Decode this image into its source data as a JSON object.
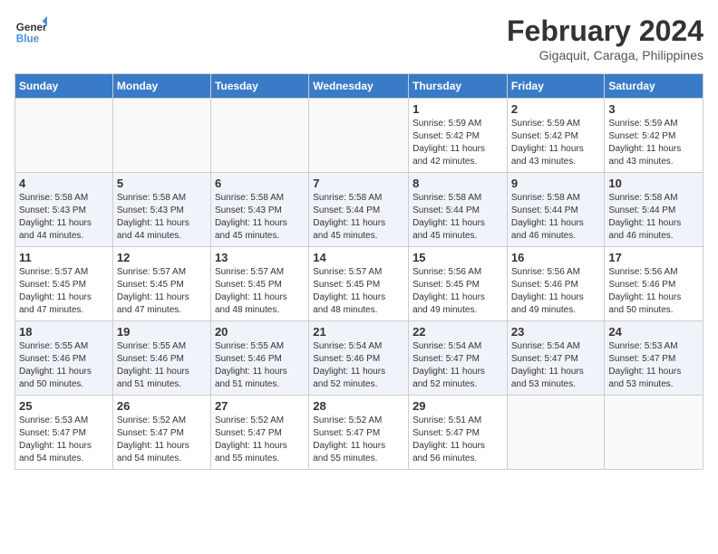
{
  "header": {
    "logo_line1": "General",
    "logo_line2": "Blue",
    "month_year": "February 2024",
    "location": "Gigaquit, Caraga, Philippines"
  },
  "weekdays": [
    "Sunday",
    "Monday",
    "Tuesday",
    "Wednesday",
    "Thursday",
    "Friday",
    "Saturday"
  ],
  "weeks": [
    [
      {
        "day": "",
        "info": ""
      },
      {
        "day": "",
        "info": ""
      },
      {
        "day": "",
        "info": ""
      },
      {
        "day": "",
        "info": ""
      },
      {
        "day": "1",
        "info": "Sunrise: 5:59 AM\nSunset: 5:42 PM\nDaylight: 11 hours\nand 42 minutes."
      },
      {
        "day": "2",
        "info": "Sunrise: 5:59 AM\nSunset: 5:42 PM\nDaylight: 11 hours\nand 43 minutes."
      },
      {
        "day": "3",
        "info": "Sunrise: 5:59 AM\nSunset: 5:42 PM\nDaylight: 11 hours\nand 43 minutes."
      }
    ],
    [
      {
        "day": "4",
        "info": "Sunrise: 5:58 AM\nSunset: 5:43 PM\nDaylight: 11 hours\nand 44 minutes."
      },
      {
        "day": "5",
        "info": "Sunrise: 5:58 AM\nSunset: 5:43 PM\nDaylight: 11 hours\nand 44 minutes."
      },
      {
        "day": "6",
        "info": "Sunrise: 5:58 AM\nSunset: 5:43 PM\nDaylight: 11 hours\nand 45 minutes."
      },
      {
        "day": "7",
        "info": "Sunrise: 5:58 AM\nSunset: 5:44 PM\nDaylight: 11 hours\nand 45 minutes."
      },
      {
        "day": "8",
        "info": "Sunrise: 5:58 AM\nSunset: 5:44 PM\nDaylight: 11 hours\nand 45 minutes."
      },
      {
        "day": "9",
        "info": "Sunrise: 5:58 AM\nSunset: 5:44 PM\nDaylight: 11 hours\nand 46 minutes."
      },
      {
        "day": "10",
        "info": "Sunrise: 5:58 AM\nSunset: 5:44 PM\nDaylight: 11 hours\nand 46 minutes."
      }
    ],
    [
      {
        "day": "11",
        "info": "Sunrise: 5:57 AM\nSunset: 5:45 PM\nDaylight: 11 hours\nand 47 minutes."
      },
      {
        "day": "12",
        "info": "Sunrise: 5:57 AM\nSunset: 5:45 PM\nDaylight: 11 hours\nand 47 minutes."
      },
      {
        "day": "13",
        "info": "Sunrise: 5:57 AM\nSunset: 5:45 PM\nDaylight: 11 hours\nand 48 minutes."
      },
      {
        "day": "14",
        "info": "Sunrise: 5:57 AM\nSunset: 5:45 PM\nDaylight: 11 hours\nand 48 minutes."
      },
      {
        "day": "15",
        "info": "Sunrise: 5:56 AM\nSunset: 5:45 PM\nDaylight: 11 hours\nand 49 minutes."
      },
      {
        "day": "16",
        "info": "Sunrise: 5:56 AM\nSunset: 5:46 PM\nDaylight: 11 hours\nand 49 minutes."
      },
      {
        "day": "17",
        "info": "Sunrise: 5:56 AM\nSunset: 5:46 PM\nDaylight: 11 hours\nand 50 minutes."
      }
    ],
    [
      {
        "day": "18",
        "info": "Sunrise: 5:55 AM\nSunset: 5:46 PM\nDaylight: 11 hours\nand 50 minutes."
      },
      {
        "day": "19",
        "info": "Sunrise: 5:55 AM\nSunset: 5:46 PM\nDaylight: 11 hours\nand 51 minutes."
      },
      {
        "day": "20",
        "info": "Sunrise: 5:55 AM\nSunset: 5:46 PM\nDaylight: 11 hours\nand 51 minutes."
      },
      {
        "day": "21",
        "info": "Sunrise: 5:54 AM\nSunset: 5:46 PM\nDaylight: 11 hours\nand 52 minutes."
      },
      {
        "day": "22",
        "info": "Sunrise: 5:54 AM\nSunset: 5:47 PM\nDaylight: 11 hours\nand 52 minutes."
      },
      {
        "day": "23",
        "info": "Sunrise: 5:54 AM\nSunset: 5:47 PM\nDaylight: 11 hours\nand 53 minutes."
      },
      {
        "day": "24",
        "info": "Sunrise: 5:53 AM\nSunset: 5:47 PM\nDaylight: 11 hours\nand 53 minutes."
      }
    ],
    [
      {
        "day": "25",
        "info": "Sunrise: 5:53 AM\nSunset: 5:47 PM\nDaylight: 11 hours\nand 54 minutes."
      },
      {
        "day": "26",
        "info": "Sunrise: 5:52 AM\nSunset: 5:47 PM\nDaylight: 11 hours\nand 54 minutes."
      },
      {
        "day": "27",
        "info": "Sunrise: 5:52 AM\nSunset: 5:47 PM\nDaylight: 11 hours\nand 55 minutes."
      },
      {
        "day": "28",
        "info": "Sunrise: 5:52 AM\nSunset: 5:47 PM\nDaylight: 11 hours\nand 55 minutes."
      },
      {
        "day": "29",
        "info": "Sunrise: 5:51 AM\nSunset: 5:47 PM\nDaylight: 11 hours\nand 56 minutes."
      },
      {
        "day": "",
        "info": ""
      },
      {
        "day": "",
        "info": ""
      }
    ]
  ]
}
